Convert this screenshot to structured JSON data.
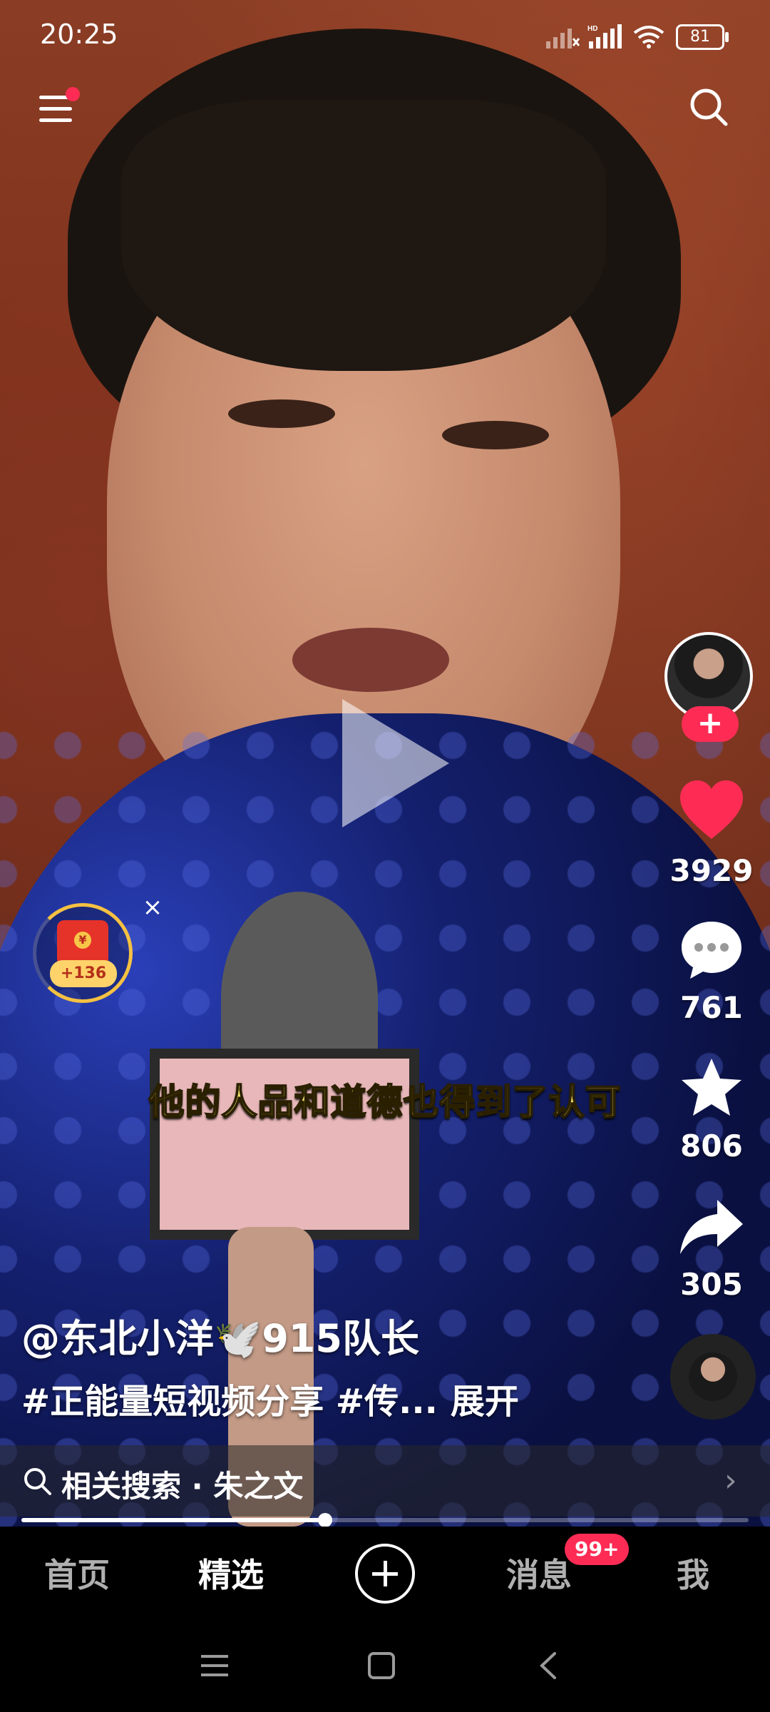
{
  "status_bar": {
    "time": "20:25",
    "network": "HD",
    "battery": "81"
  },
  "video": {
    "subtitle": "他的人品和道德也得到了认可"
  },
  "top_bar": {
    "menu_icon": "menu-icon",
    "search_icon": "search-icon",
    "has_notification_dot": true
  },
  "right_rail": {
    "follow_label": "+",
    "likes": "3929",
    "comments": "761",
    "favorites": "806",
    "shares": "305"
  },
  "red_packet": {
    "bonus": "+136",
    "seal": "¥",
    "close": "×"
  },
  "caption": {
    "author": "@东北小洋🕊️915队长",
    "description": "#正能量短视频分享 #传...",
    "expand": "展开"
  },
  "related_search": {
    "text": "相关搜索 · 朱之文",
    "arrow": "›"
  },
  "playback": {
    "progress": 0.418
  },
  "bottom_nav": {
    "home": "首页",
    "featured": "精选",
    "messages": "消息",
    "messages_badge": "99+",
    "me": "我"
  },
  "colors": {
    "accent": "#fe2c55",
    "subtitle": "#f6e36a",
    "jacket": "#1a2a9a"
  }
}
